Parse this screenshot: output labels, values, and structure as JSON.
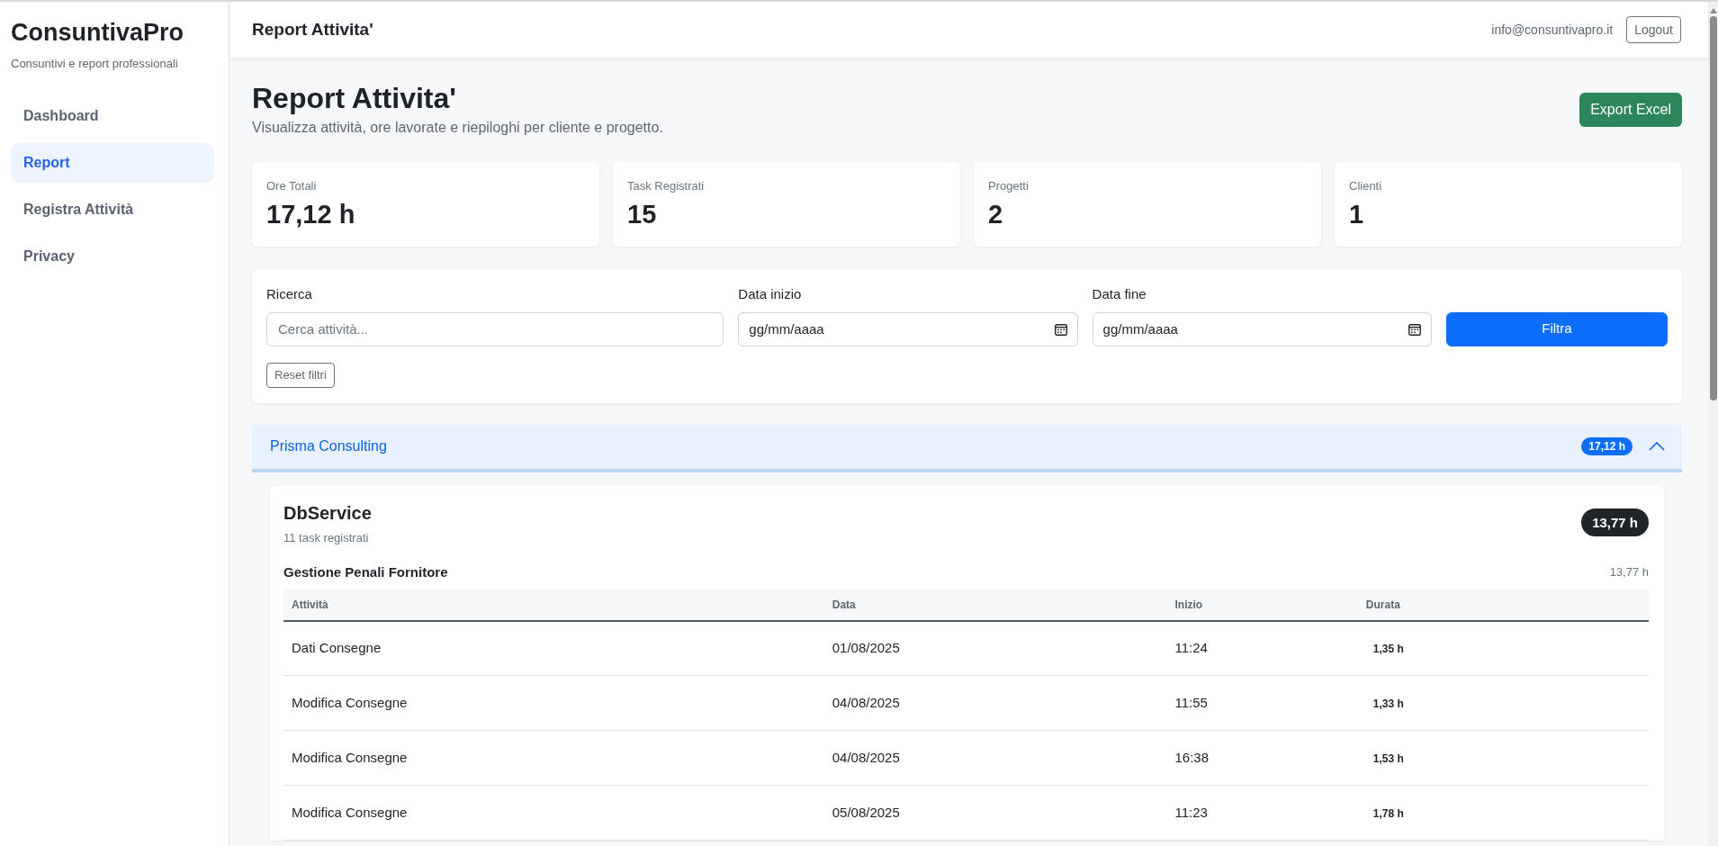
{
  "sidebar": {
    "brand": "ConsuntivaPro",
    "tagline": "Consuntivi e report professionali",
    "items": [
      {
        "label": "Dashboard",
        "selected": false
      },
      {
        "label": "Report",
        "selected": true
      },
      {
        "label": "Registra Attività",
        "selected": false
      },
      {
        "label": "Privacy",
        "selected": false
      }
    ]
  },
  "header": {
    "title": "Report Attivita'",
    "user_email": "info@consuntivapro.it",
    "logout_button": "Logout"
  },
  "page": {
    "title": "Report Attivita'",
    "subtitle": "Visualizza attività, ore lavorate e riepiloghi per cliente e progetto.",
    "export_button": "Export Excel"
  },
  "stats": [
    {
      "label": "Ore Totali",
      "value": "17,12 h"
    },
    {
      "label": "Task Registrati",
      "value": "15"
    },
    {
      "label": "Progetti",
      "value": "2"
    },
    {
      "label": "Clienti",
      "value": "1"
    }
  ],
  "filters": {
    "fields": [
      {
        "kind": "text",
        "label": "Ricerca",
        "placeholder": "Cerca attività..."
      },
      {
        "kind": "date",
        "label": "Data inizio",
        "placeholder": "gg/mm/aaaa"
      },
      {
        "kind": "date",
        "label": "Data fine",
        "placeholder": "gg/mm/aaaa"
      }
    ],
    "filter_button": "Filtra",
    "reset_button": "Reset filtri"
  },
  "clients": [
    {
      "name": "Prisma Consulting",
      "total": "17,12 h",
      "expanded": true,
      "projects": [
        {
          "name": "DbService",
          "task_count": "11 task registrati",
          "total": "13,77 h",
          "groups": [
            {
              "name": "Gestione Penali Fornitore",
              "total": "13,77 h",
              "table": {
                "columns": [
                  "Attività",
                  "Data",
                  "Inizio",
                  "Durata"
                ],
                "rows": [
                  {
                    "activity": "Dati Consegne",
                    "date": "01/08/2025",
                    "start": "11:24",
                    "duration": "1,35 h"
                  },
                  {
                    "activity": "Modifica Consegne",
                    "date": "04/08/2025",
                    "start": "11:55",
                    "duration": "1,33 h"
                  },
                  {
                    "activity": "Modifica Consegne",
                    "date": "04/08/2025",
                    "start": "16:38",
                    "duration": "1,53 h"
                  },
                  {
                    "activity": "Modifica Consegne",
                    "date": "05/08/2025",
                    "start": "11:23",
                    "duration": "1,78 h"
                  }
                ]
              }
            }
          ]
        }
      ]
    }
  ]
}
